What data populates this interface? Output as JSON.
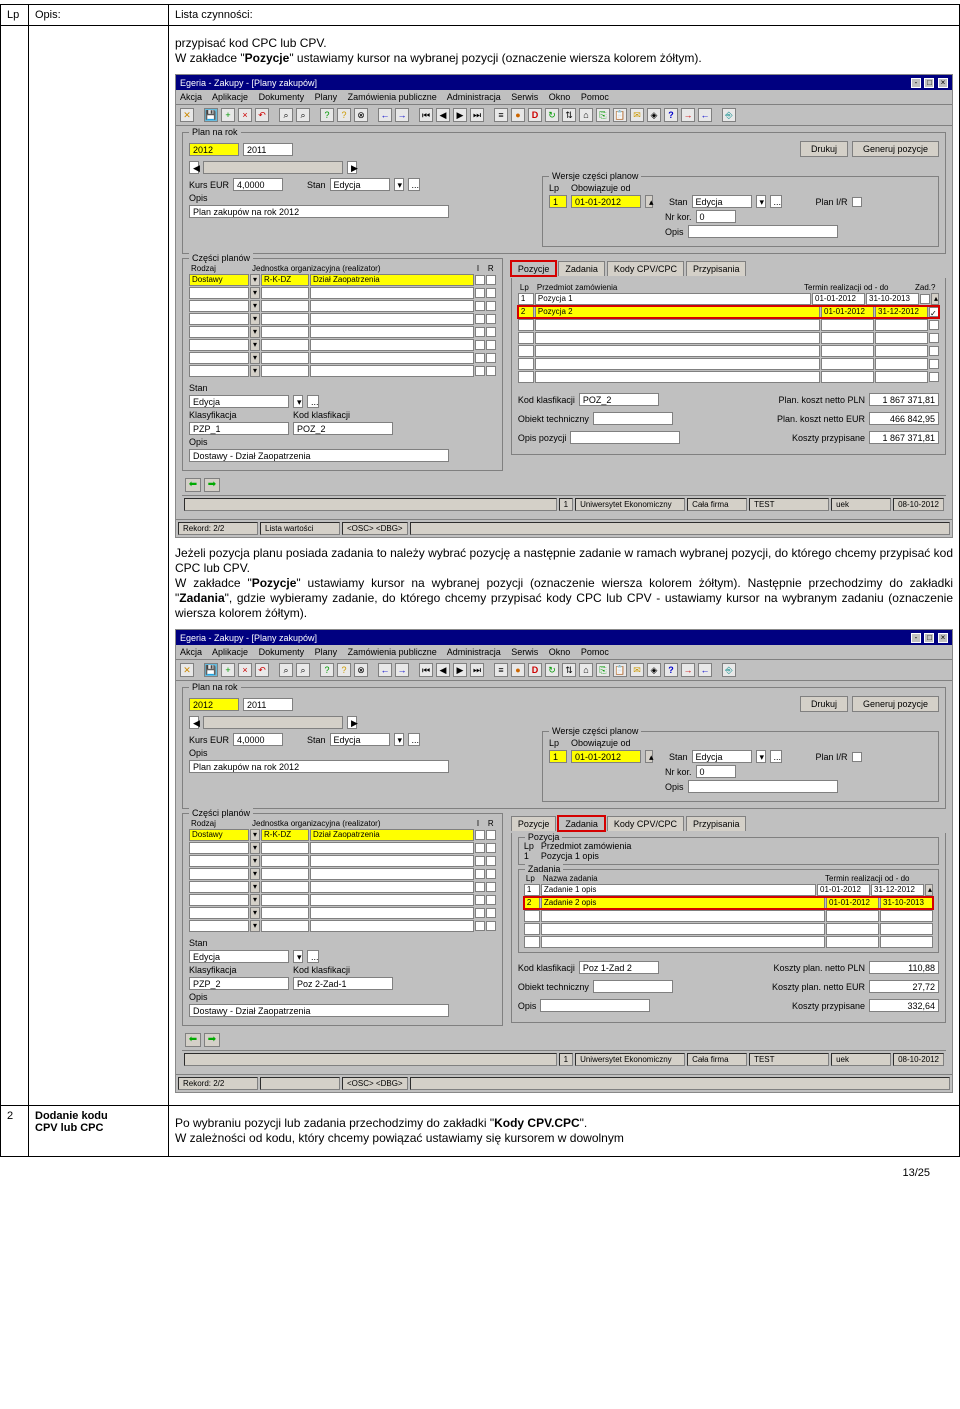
{
  "header": {
    "lp_label": "Lp",
    "opis_label": "Opis:",
    "lista_label": "Lista czynności:"
  },
  "intro": {
    "p1_pre": "przypisać kod CPC lub CPV.",
    "p1_main_a": "W zakładce \"",
    "p1_main_b": "Pozycje",
    "p1_main_c": "\" ustawiamy kursor na wybranej pozycji (oznaczenie wiersza kolorem żółtym)."
  },
  "mid_para": {
    "a": "Jeżeli pozycja planu posiada zadania to należy wybrać pozycję a następnie zadanie w ramach wybranej pozycji, do którego chcemy przypisać kod CPC lub CPV.",
    "b_a": "W zakładce \"",
    "b_b": "Pozycje",
    "b_c": "\" ustawiamy kursor na wybranej pozycji (oznaczenie wiersza kolorem żółtym). Następnie przechodzimy do zakładki \"",
    "b_d": "Zadania",
    "b_e": "\", gdzie wybieramy zadanie, do którego chcemy przypisać kody CPC lub CPV - ustawiamy kursor na wybranym zadaniu (oznaczenie wiersza kolorem żółtym)."
  },
  "row2": {
    "lp": "2",
    "opis_a": "Dodanie kodu",
    "opis_b": "CPV lub CPC",
    "text_a": "Po wybraniu pozycji lub zadania przechodzimy do zakładki \"",
    "text_b": "Kody CPV.CPC",
    "text_c": "\".",
    "text_d": "W zależności od kodu, który chcemy powiązać ustawiamy się kursorem w dowolnym"
  },
  "app1": {
    "title": "Egeria - Zakupy - [Plany zakupów]",
    "menu": [
      "Akcja",
      "Aplikacje",
      "Dokumenty",
      "Plany",
      "Zamówienia publiczne",
      "Administracja",
      "Serwis",
      "Okno",
      "Pomoc"
    ],
    "plan_label": "Plan na rok",
    "rok1": "2012",
    "rok2": "2011",
    "kurs_label": "Kurs EUR",
    "kurs": "4,0000",
    "stan_label": "Stan",
    "stan": "Edycja",
    "opis_label": "Opis",
    "opis": "Plan zakupów na rok 2012",
    "btn_drukuj": "Drukuj",
    "btn_gen": "Generuj pozycje",
    "wersje_grp": "Wersje części planow",
    "lp_lbl": "Lp",
    "obow_lbl": "Obowiązuje od",
    "wersja_lp": "1",
    "wersja_data": "01-01-2012",
    "stan2_lbl": "Stan",
    "stan2": "Edycja",
    "nrkor_lbl": "Nr kor.",
    "nrkor": "0",
    "opis2_lbl": "Opis",
    "planir_lbl": "Plan I/R",
    "czesci_grp": "Części planów",
    "rodzaj_lbl": "Rodzaj",
    "jedn_lbl": "Jednostka organizacyjna (realizator)",
    "i_lbl": "I",
    "r_lbl": "R",
    "rodzaj_val": "Dostawy",
    "jedn_code": "R-K-DZ",
    "jedn_val": "Dział Zaopatrzenia",
    "stan3_lbl": "Stan",
    "stan3": "Edycja",
    "klas_lbl": "Klasyfikacja",
    "klas_val": "PZP_1",
    "kodklas_lbl": "Kod klasfikacji",
    "kodklas_val": "POZ_2",
    "opis3_lbl": "Opis",
    "opis3_val": "Dostawy - Dział Zaopatrzenia",
    "tabs": [
      "Pozycje",
      "Zadania",
      "Kody CPV/CPC",
      "Przypisania"
    ],
    "pozycje_hdr_lp": "Lp",
    "pozycje_hdr_prz": "Przedmiot zamówienia",
    "pozycje_hdr_term": "Termin realizacji od - do",
    "pozycje_hdr_zad": "Zad.?",
    "poz1_lp": "1",
    "poz1_nm": "Pozycja 1",
    "poz1_d1": "01-01-2012",
    "poz1_d2": "31-10-2013",
    "poz2_lp": "2",
    "poz2_nm": "Pozycja 2",
    "poz2_d1": "01-01-2012",
    "poz2_d2": "31-12-2012",
    "kodklas2_lbl": "Kod klasfikacji",
    "kodklas2_val": "POZ_2",
    "obt_lbl": "Obiekt techniczny",
    "opispoz_lbl": "Opis pozycji",
    "plan_pln_lbl": "Plan. koszt netto PLN",
    "plan_pln": "1 867 371,81",
    "plan_eur_lbl": "Plan. koszt netto EUR",
    "plan_eur": "466 842,95",
    "koszt_prz_lbl": "Koszty przypisane",
    "koszt_prz": "1 867 371,81",
    "status": {
      "s1": "1",
      "s2": "Uniwersytet Ekonomiczny",
      "s3": "Cała firma",
      "s4": "TEST",
      "s5": "uek",
      "s6": "08-10-2012"
    },
    "rekord_lbl": "Rekord: 2/2",
    "listaw_lbl": "Lista wartości",
    "osc_lbl": "<OSC> <DBG>"
  },
  "app2": {
    "title": "Egeria - Zakupy - [Plany zakupów]",
    "menu": [
      "Akcja",
      "Aplikacje",
      "Dokumenty",
      "Plany",
      "Zamówienia publiczne",
      "Administracja",
      "Serwis",
      "Okno",
      "Pomoc"
    ],
    "plan_label": "Plan na rok",
    "rok1": "2012",
    "rok2": "2011",
    "kurs_label": "Kurs EUR",
    "kurs": "4,0000",
    "stan_label": "Stan",
    "stan": "Edycja",
    "opis_label": "Opis",
    "opis": "Plan zakupów na rok 2012",
    "btn_drukuj": "Drukuj",
    "btn_gen": "Generuj pozycje",
    "wersje_grp": "Wersje części planow",
    "lp_lbl": "Lp",
    "obow_lbl": "Obowiązuje od",
    "wersja_lp": "1",
    "wersja_data": "01-01-2012",
    "stan2_lbl": "Stan",
    "stan2": "Edycja",
    "nrkor_lbl": "Nr kor.",
    "nrkor": "0",
    "opis2_lbl": "Opis",
    "planir_lbl": "Plan I/R",
    "czesci_grp": "Części planów",
    "rodzaj_lbl": "Rodzaj",
    "jedn_lbl": "Jednostka organizacyjna (realizator)",
    "i_lbl": "I",
    "r_lbl": "R",
    "rodzaj_val": "Dostawy",
    "jedn_code": "R-K-DZ",
    "jedn_val": "Dział Zaopatrzenia",
    "stan3_lbl": "Stan",
    "stan3": "Edycja",
    "klas_lbl": "Klasyfikacja",
    "klas_val": "PZP_2",
    "kodklas_lbl": "Kod klasfikacji",
    "kodklas_val": "Poz 2-Zad-1",
    "opis3_lbl": "Opis",
    "opis3_val": "Dostawy - Dział Zaopatrzenia",
    "tabs": [
      "Pozycje",
      "Zadania",
      "Kody CPV/CPC",
      "Przypisania"
    ],
    "poz_grp": "Pozycja",
    "poz_hdr_lp": "Lp",
    "poz_hdr_prz": "Przedmiot zamówienia",
    "poz1_lp": "1",
    "poz1_nm": "Pozycja 1 opis",
    "zad_grp": "Zadania",
    "zad_hdr_lp": "Lp",
    "zad_hdr_nz": "Nazwa zadania",
    "zad_hdr_term": "Termin realizacji od - do",
    "zad1_lp": "1",
    "zad1_nm": "Zadanie 1 opis",
    "zad1_d1": "01-01-2012",
    "zad1_d2": "31-12-2012",
    "zad2_lp": "2",
    "zad2_nm": "Zadanie 2 opis",
    "zad2_d1": "01-01-2012",
    "zad2_d2": "31-10-2013",
    "kodklas2_lbl": "Kod klasfikacji",
    "kodklas2_val": "Poz 1-Zad 2",
    "obt_lbl": "Obiekt techniczny",
    "opis4_lbl": "Opis",
    "plan_pln_lbl": "Koszty plan. netto PLN",
    "plan_pln": "110,88",
    "plan_eur_lbl": "Koszty plan. netto EUR",
    "plan_eur": "27,72",
    "koszt_prz_lbl": "Koszty przypisane",
    "koszt_prz": "332,64",
    "status": {
      "s1": "1",
      "s2": "Uniwersytet Ekonomiczny",
      "s3": "Cała firma",
      "s4": "TEST",
      "s5": "uek",
      "s6": "08-10-2012"
    },
    "rekord_lbl": "Rekord: 2/2",
    "osc_lbl": "<OSC> <DBG>"
  },
  "page_num": "13/25"
}
